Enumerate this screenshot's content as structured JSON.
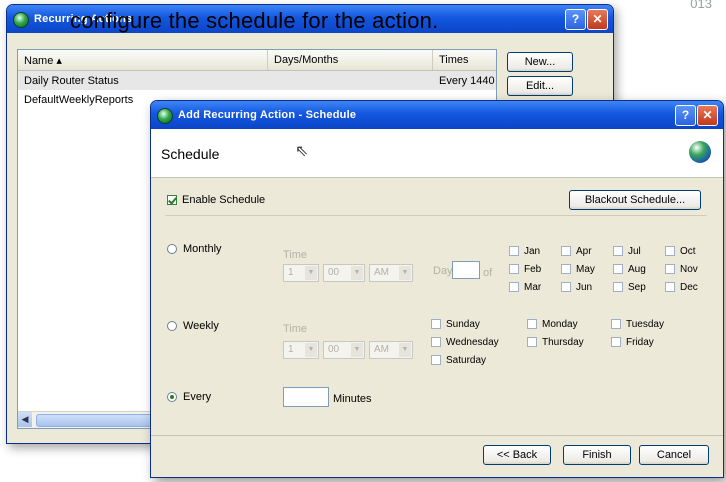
{
  "corner_number": "013",
  "caption": "configure the schedule for the action.",
  "back_window": {
    "title": "Recurring Actions",
    "columns": [
      "Name ▴",
      "Days/Months",
      "Times"
    ],
    "rows": [
      {
        "name": "Daily Router Status",
        "days": "",
        "times": "Every 1440"
      },
      {
        "name": "DefaultWeeklyReports",
        "days": "",
        "times": ""
      }
    ],
    "buttons": {
      "new": "New...",
      "edit": "Edit..."
    }
  },
  "dialog": {
    "title": "Add Recurring Action - Schedule",
    "header_title": "Schedule",
    "enable_schedule": {
      "label": "Enable Schedule",
      "checked": true
    },
    "blackout_button": "Blackout Schedule...",
    "monthly": {
      "label": "Monthly",
      "time_label": "Time",
      "hour": "1",
      "minute": "00",
      "ampm": "AM",
      "day_label": "Day",
      "of_label": "of",
      "months": [
        "Jan",
        "Apr",
        "Jul",
        "Oct",
        "Feb",
        "May",
        "Aug",
        "Nov",
        "Mar",
        "Jun",
        "Sep",
        "Dec"
      ]
    },
    "weekly": {
      "label": "Weekly",
      "time_label": "Time",
      "hour": "1",
      "minute": "00",
      "ampm": "AM",
      "days": [
        "Sunday",
        "Monday",
        "Tuesday",
        "Wednesday",
        "Thursday",
        "Friday",
        "Saturday"
      ]
    },
    "every": {
      "label": "Every",
      "value": "",
      "unit": "Minutes",
      "selected": true
    },
    "buttons": {
      "back": "<< Back",
      "finish": "Finish",
      "cancel": "Cancel"
    }
  },
  "colors": {
    "titlebar": "#1457df",
    "dialog_bg": "#ece9d8",
    "check": "#2b7a2b"
  }
}
